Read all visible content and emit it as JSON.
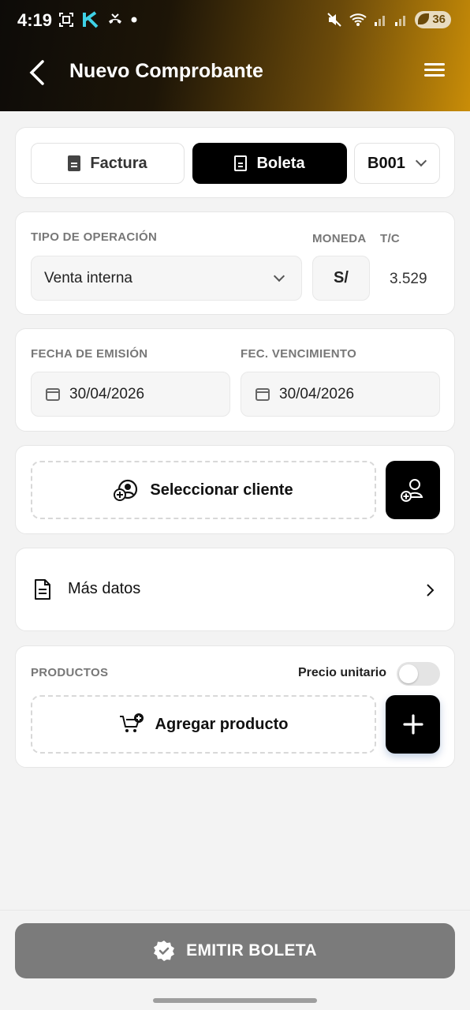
{
  "status_bar": {
    "time": "4:19",
    "battery": "36"
  },
  "header": {
    "title": "Nuevo Comprobante"
  },
  "doc_type": {
    "factura_label": "Factura",
    "boleta_label": "Boleta",
    "selected": "Boleta",
    "serie_value": "B001"
  },
  "operation": {
    "tipo_label": "TIPO DE OPERACIÓN",
    "tipo_value": "Venta interna",
    "moneda_label": "MONEDA",
    "moneda_value": "S/",
    "tc_label": "T/C",
    "tc_value": "3.529"
  },
  "dates": {
    "emision_label": "FECHA DE EMISIÓN",
    "emision_value": "30/04/2026",
    "vencimiento_label": "FEC. VENCIMIENTO",
    "vencimiento_value": "30/04/2026"
  },
  "client": {
    "select_label": "Seleccionar cliente"
  },
  "more_data": {
    "label": "Más datos"
  },
  "products": {
    "label": "PRODUCTOS",
    "unit_price_label": "Precio unitario",
    "unit_price_enabled": false,
    "add_label": "Agregar producto"
  },
  "footer": {
    "emit_label": "EMITIR BOLETA"
  },
  "colors": {
    "accent": "#000000",
    "header_gradient_end": "#c98d08",
    "emit_button": "#7b7b7b"
  }
}
